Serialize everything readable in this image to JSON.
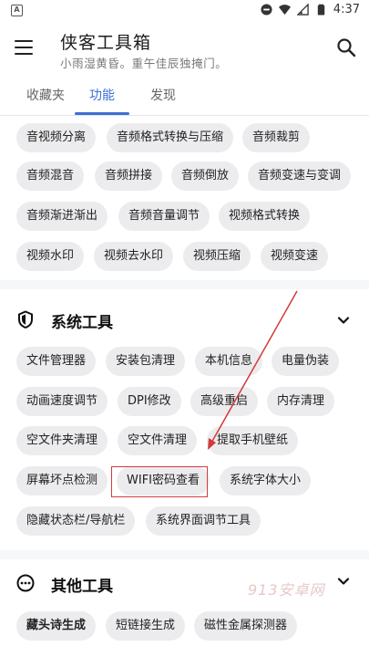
{
  "status_bar": {
    "left_icon_letter": "A",
    "time": "4:37"
  },
  "app_bar": {
    "title": "侠客工具箱",
    "subtitle": "小雨湿黄昏。重午佳辰独掩门。"
  },
  "tabs": [
    {
      "label": "收藏夹",
      "active": false
    },
    {
      "label": "功能",
      "active": true
    },
    {
      "label": "发现",
      "active": false
    }
  ],
  "audio_video_tools": [
    "音视频分离",
    "音频格式转换与压缩",
    "音频裁剪",
    "音频混音",
    "音频拼接",
    "音频倒放",
    "音频变速与变调",
    "音频渐进渐出",
    "音频音量调节",
    "视频格式转换",
    "视频水印",
    "视频去水印",
    "视频压缩",
    "视频变速"
  ],
  "system_section": {
    "title": "系统工具",
    "icon": "shield-icon",
    "items": [
      "文件管理器",
      "安装包清理",
      "本机信息",
      "电量伪装",
      "动画速度调节",
      "DPI修改",
      "高级重启",
      "内存清理",
      "空文件夹清理",
      "空文件清理",
      "提取手机壁纸",
      "屏幕坏点检测",
      "WIFI密码查看",
      "系统字体大小",
      "隐藏状态栏/导航栏",
      "系统界面调节工具"
    ],
    "highlighted_item": "WIFI密码查看"
  },
  "other_section": {
    "title": "其他工具",
    "icon": "more-circle-icon",
    "items": [
      "藏头诗生成",
      "短链接生成",
      "磁性金属探测器"
    ]
  },
  "watermark": "913安卓网",
  "colors": {
    "accent": "#3a6fd6",
    "chip_bg": "#ececee",
    "highlight": "#d23b3b"
  }
}
